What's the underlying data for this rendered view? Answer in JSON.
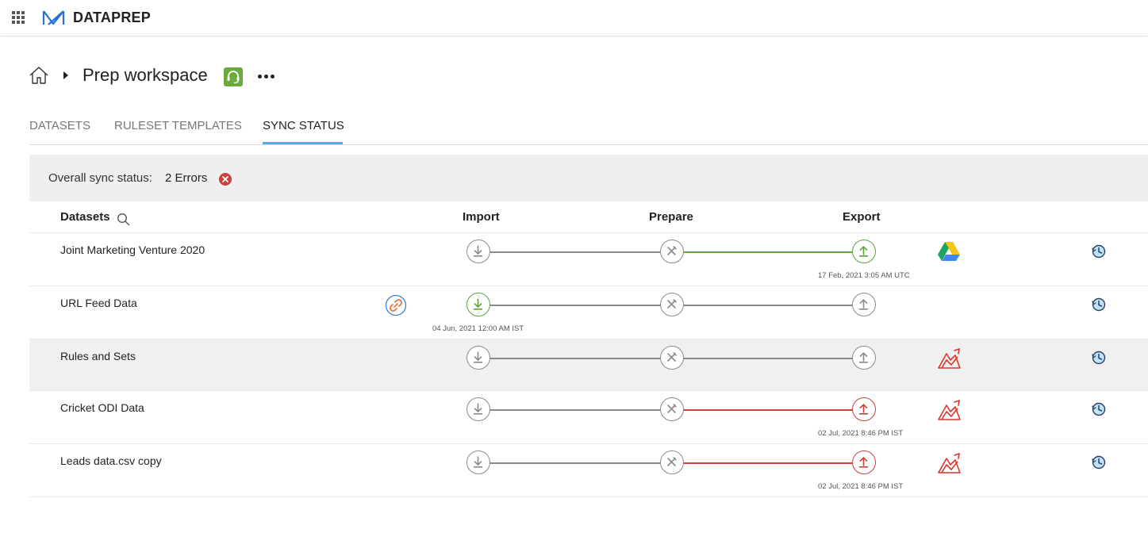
{
  "app": {
    "brand": "DATAPREP"
  },
  "breadcrumb": {
    "workspace_title": "Prep workspace"
  },
  "tabs": [
    {
      "label": "DATASETS",
      "active": false
    },
    {
      "label": "RULESET TEMPLATES",
      "active": false
    },
    {
      "label": "SYNC STATUS",
      "active": true
    }
  ],
  "sync": {
    "label": "Overall sync status:",
    "value": "2 Errors"
  },
  "table": {
    "headers": {
      "datasets": "Datasets",
      "import": "Import",
      "prepare": "Prepare",
      "export": "Export"
    },
    "rows": [
      {
        "name": "Joint Marketing Venture 2020",
        "import_state": "idle",
        "export_state": "success",
        "timestamp": "17 Feb, 2021 3:05 AM UTC",
        "timestamp_under": "export",
        "destination": "google-drive-icon",
        "source_icon": ""
      },
      {
        "name": "URL Feed Data",
        "import_state": "success",
        "export_state": "idle",
        "timestamp": "04 Jun, 2021 12:00 AM IST",
        "timestamp_under": "import",
        "destination": "",
        "source_icon": "link-icon"
      },
      {
        "name": "Rules and Sets",
        "import_state": "idle",
        "export_state": "idle",
        "timestamp": "",
        "timestamp_under": "",
        "destination": "zoho-analytics-icon",
        "source_icon": ""
      },
      {
        "name": "Cricket ODI Data",
        "import_state": "idle",
        "export_state": "error",
        "timestamp": "02 Jul, 2021 8:46 PM IST",
        "timestamp_under": "export",
        "destination": "zoho-analytics-icon",
        "source_icon": ""
      },
      {
        "name": "Leads data.csv copy",
        "import_state": "idle",
        "export_state": "error",
        "timestamp": "02 Jul, 2021 8:46 PM IST",
        "timestamp_under": "export",
        "destination": "zoho-analytics-icon",
        "source_icon": ""
      }
    ]
  },
  "colors": {
    "accent": "#41b3e6",
    "success": "#5fa33a",
    "error": "#c9423d",
    "neutral": "#8a8a8a",
    "support": "#6aab3c"
  }
}
